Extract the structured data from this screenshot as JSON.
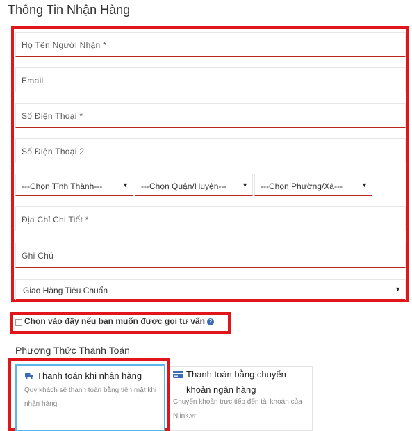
{
  "title": "Thông Tin Nhận Hàng",
  "fields": {
    "name": "Họ Tên Người Nhận *",
    "email": "Email",
    "phone": "Số Điện Thoại *",
    "phone2": "Số Điện Thoại 2",
    "address": "Địa Chỉ Chi Tiết *",
    "note": "Ghi Chú"
  },
  "selects": {
    "province": "---Chọn Tỉnh Thành---",
    "district": "---Chọn Quận/Huyện---",
    "ward": "---Chọn Phường/Xã---",
    "shipping": "Giao Hàng Tiêu Chuẩn"
  },
  "consult": {
    "label": "Chọn vào đây nếu bạn muốn được gọi tư vấn",
    "checked": false
  },
  "payment": {
    "title": "Phương Thức Thanh Toán",
    "cod": {
      "title": "Thanh toán khi nhận hàng",
      "desc": "Quý khách sẽ thanh toán bằng tiền mặt khi nhận hàng"
    },
    "bank": {
      "title": "Thanh toán bằng chuyển khoản ngân hàng",
      "desc": "Chuyển khoản trực tiếp đến tài khoản của Nlink.vn"
    }
  },
  "colors": {
    "highlight_frame": "#e0161b",
    "field_underline": "#b8261d",
    "selected_card_border": "#58b7e6",
    "icon_blue": "#3b6bb5"
  },
  "icons": {
    "truck": "truck-icon",
    "card": "credit-card-icon",
    "help": "question-circle-icon",
    "caret": "caret-down-icon"
  }
}
